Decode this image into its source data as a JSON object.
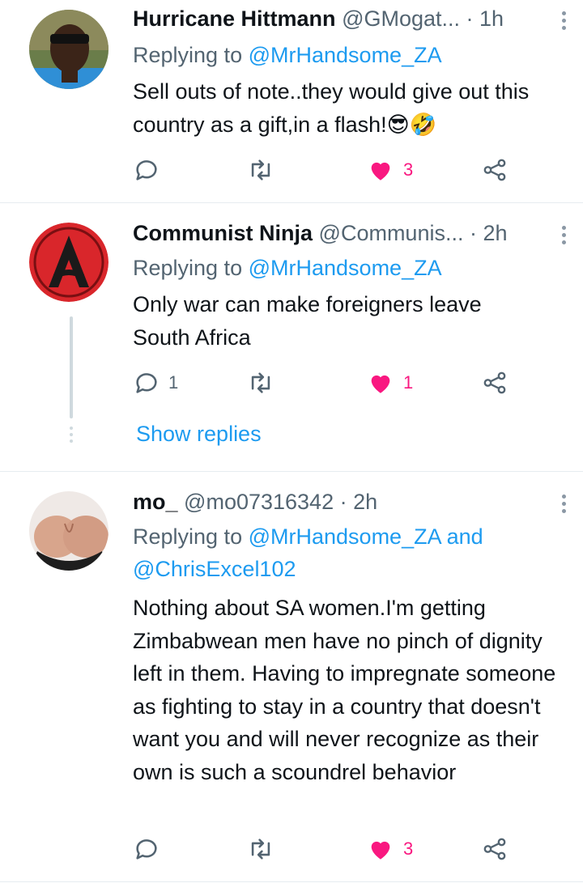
{
  "colors": {
    "link": "#1d9bf0",
    "like": "#f91880",
    "grey": "#536471"
  },
  "tweets": [
    {
      "name": "Hurricane Hittmann",
      "handle": "@GMogat...",
      "time": "· 1h",
      "replying_prefix": "Replying to",
      "replying_to": "@MrHandsome_ZA",
      "text": "Sell outs of note..they would give out this country as a gift,in a flash!😎🤣",
      "replies": "",
      "retweets": "",
      "likes": "3",
      "liked": true
    },
    {
      "name": "Communist Ninja",
      "handle": "@Communis...",
      "time": "· 2h",
      "replying_prefix": "Replying to",
      "replying_to": "@MrHandsome_ZA",
      "text": "Only war can make foreigners leave South Africa",
      "replies": "1",
      "retweets": "",
      "likes": "1",
      "liked": true,
      "show_replies": "Show replies"
    },
    {
      "name": "mo_",
      "handle": "@mo07316342",
      "time": "· 2h",
      "replying_prefix": "Replying to",
      "replying_to": "@MrHandsome_ZA and @ChrisExcel102",
      "text": "Nothing about SA women.I'm getting Zimbabwean men have no pinch of dignity left in them. Having to impregnate someone as fighting to stay in a country that doesn't want you and will never recognize as their own is such a scoundrel behavior",
      "replies": "",
      "retweets": "",
      "likes": "3",
      "liked": true
    }
  ]
}
